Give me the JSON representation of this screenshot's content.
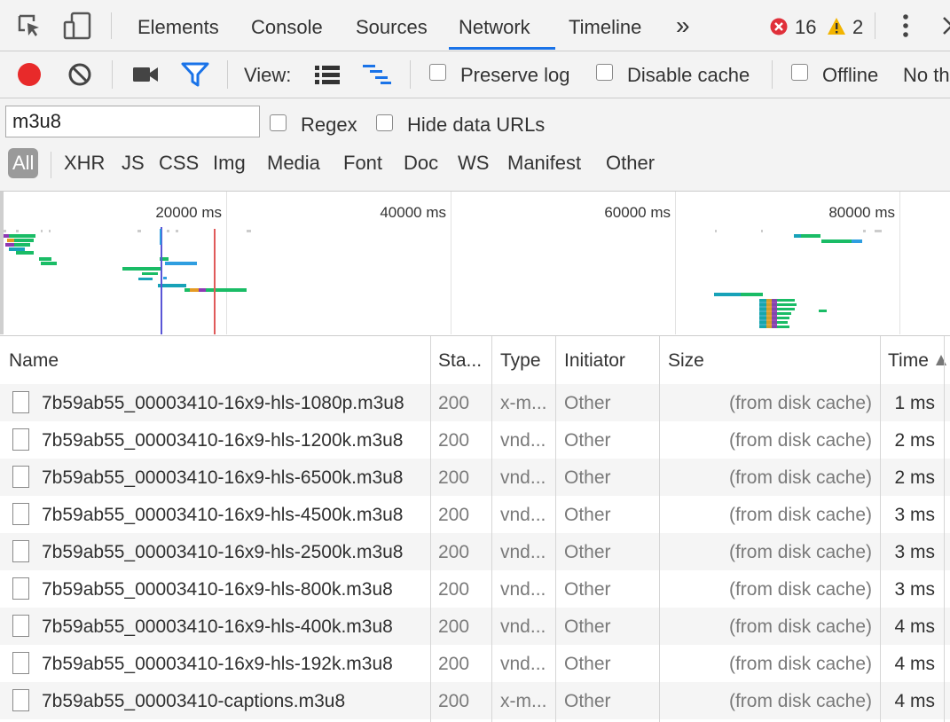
{
  "tabs": {
    "elements": "Elements",
    "console": "Console",
    "sources": "Sources",
    "network": "Network",
    "timeline": "Timeline",
    "more": "»"
  },
  "status": {
    "errors": "16",
    "warnings": "2"
  },
  "toolbar": {
    "view_label": "View:",
    "preserve_log": "Preserve log",
    "disable_cache": "Disable cache",
    "offline": "Offline",
    "throttling": "No th"
  },
  "filter": {
    "value": "m3u8",
    "regex": "Regex",
    "hide_data_urls": "Hide data URLs",
    "types": [
      "All",
      "XHR",
      "JS",
      "CSS",
      "Img",
      "Media",
      "Font",
      "Doc",
      "WS",
      "Manifest",
      "Other"
    ]
  },
  "overview": {
    "ticks": [
      "20000 ms",
      "40000 ms",
      "60000 ms",
      "80000 ms"
    ]
  },
  "columns": {
    "name": "Name",
    "status": "Sta...",
    "type": "Type",
    "initiator": "Initiator",
    "size": "Size",
    "time": "Time"
  },
  "rows": [
    {
      "name": "7b59ab55_00003410-16x9-hls-1080p.m3u8",
      "status": "200",
      "type": "x-m...",
      "initiator": "Other",
      "size": "(from disk cache)",
      "time": "1 ms"
    },
    {
      "name": "7b59ab55_00003410-16x9-hls-1200k.m3u8",
      "status": "200",
      "type": "vnd...",
      "initiator": "Other",
      "size": "(from disk cache)",
      "time": "2 ms"
    },
    {
      "name": "7b59ab55_00003410-16x9-hls-6500k.m3u8",
      "status": "200",
      "type": "vnd...",
      "initiator": "Other",
      "size": "(from disk cache)",
      "time": "2 ms"
    },
    {
      "name": "7b59ab55_00003410-16x9-hls-4500k.m3u8",
      "status": "200",
      "type": "vnd...",
      "initiator": "Other",
      "size": "(from disk cache)",
      "time": "3 ms"
    },
    {
      "name": "7b59ab55_00003410-16x9-hls-2500k.m3u8",
      "status": "200",
      "type": "vnd...",
      "initiator": "Other",
      "size": "(from disk cache)",
      "time": "3 ms"
    },
    {
      "name": "7b59ab55_00003410-16x9-hls-800k.m3u8",
      "status": "200",
      "type": "vnd...",
      "initiator": "Other",
      "size": "(from disk cache)",
      "time": "3 ms"
    },
    {
      "name": "7b59ab55_00003410-16x9-hls-400k.m3u8",
      "status": "200",
      "type": "vnd...",
      "initiator": "Other",
      "size": "(from disk cache)",
      "time": "4 ms"
    },
    {
      "name": "7b59ab55_00003410-16x9-hls-192k.m3u8",
      "status": "200",
      "type": "vnd...",
      "initiator": "Other",
      "size": "(from disk cache)",
      "time": "4 ms"
    },
    {
      "name": "7b59ab55_00003410-captions.m3u8",
      "status": "200",
      "type": "x-m...",
      "initiator": "Other",
      "size": "(from disk cache)",
      "time": "4 ms"
    }
  ],
  "colors": {
    "record": "#e82a2a",
    "accent": "#1a73e8",
    "filter_active": "#1a73e8",
    "error": "#e0303a",
    "warning": "#f2b400"
  }
}
